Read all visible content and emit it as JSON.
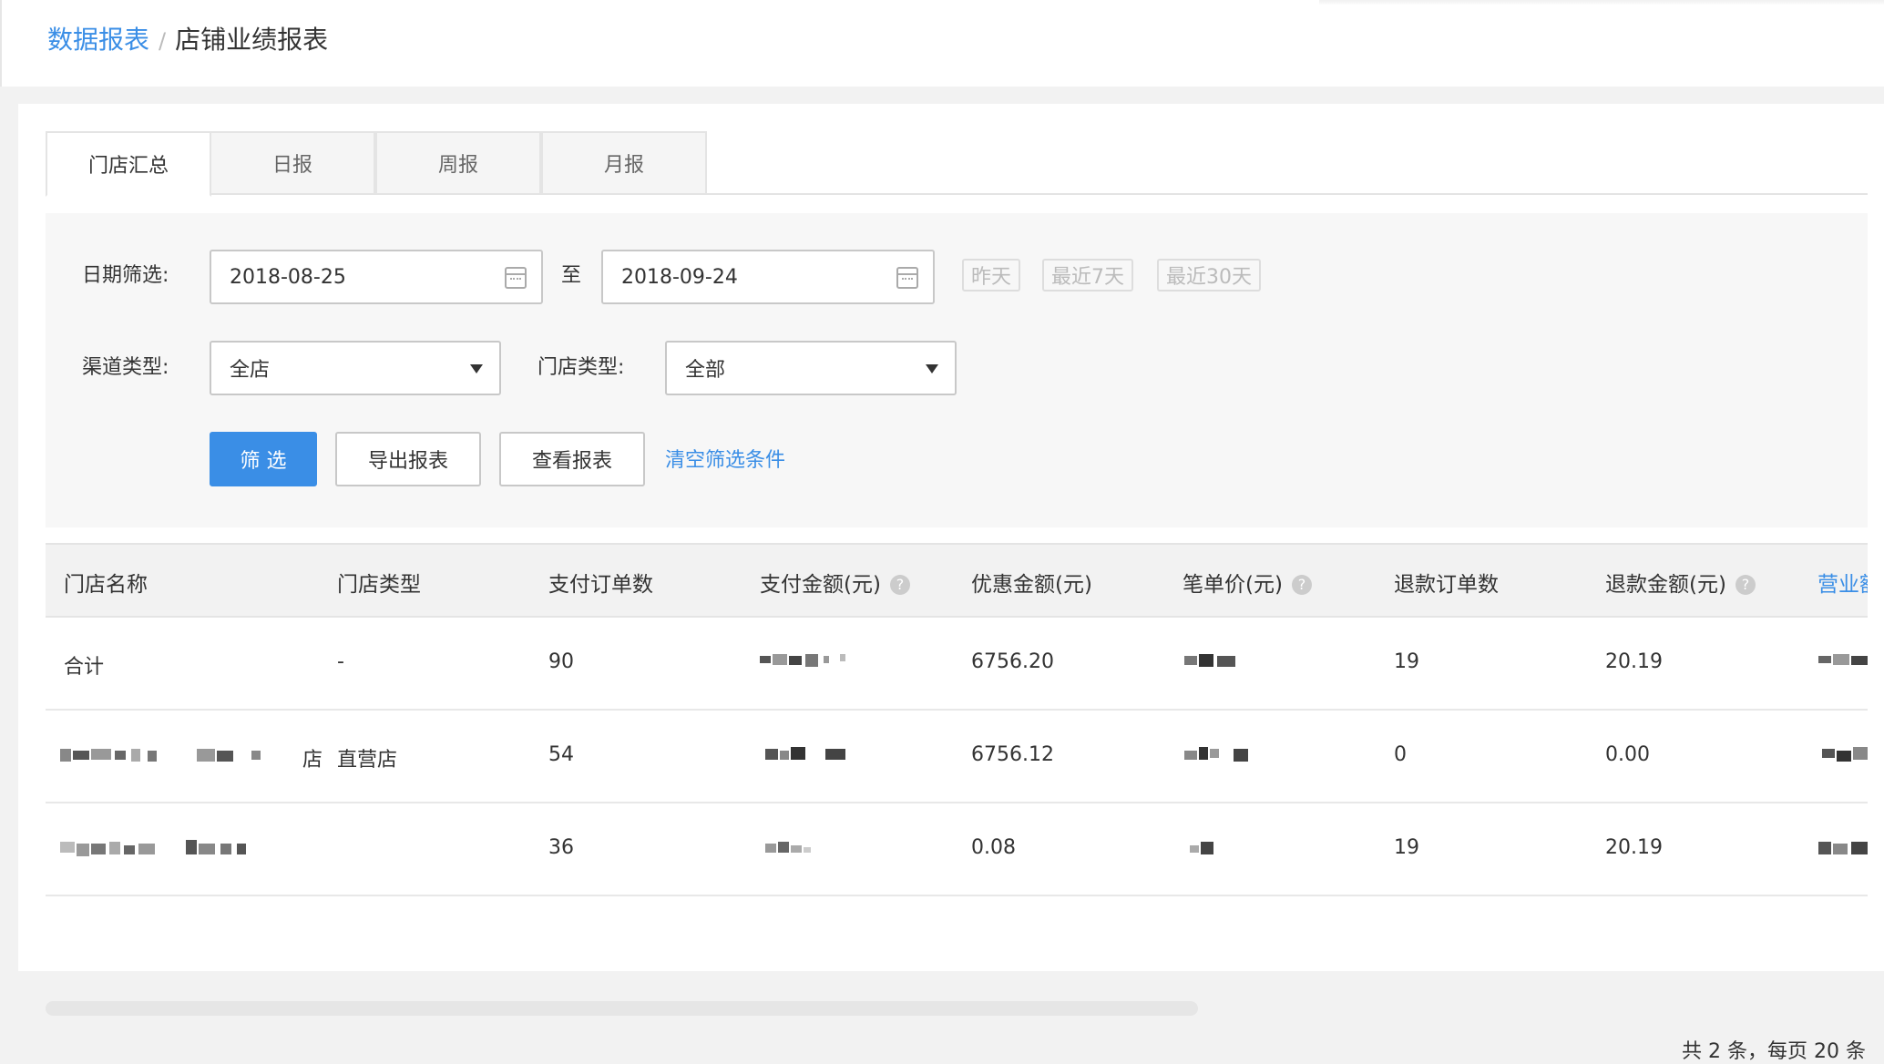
{
  "breadcrumb": {
    "parent": "数据报表",
    "separator": "/",
    "current": "店铺业绩报表"
  },
  "tabs": [
    {
      "label": "门店汇总",
      "active": true
    },
    {
      "label": "日报",
      "active": false
    },
    {
      "label": "周报",
      "active": false
    },
    {
      "label": "月报",
      "active": false
    }
  ],
  "filters": {
    "date_label": "日期筛选:",
    "start_date": "2018-08-25",
    "to_label": "至",
    "end_date": "2018-09-24",
    "quick_ranges": [
      "昨天",
      "最近7天",
      "最近30天"
    ],
    "channel_label": "渠道类型:",
    "channel_value": "全店",
    "store_type_label": "门店类型:",
    "store_type_value": "全部",
    "filter_button": "筛 选",
    "export_button": "导出报表",
    "view_button": "查看报表",
    "clear_link": "清空筛选条件"
  },
  "table": {
    "columns": [
      {
        "label": "门店名称",
        "help": false
      },
      {
        "label": "门店类型",
        "help": false
      },
      {
        "label": "支付订单数",
        "help": false
      },
      {
        "label": "支付金额(元)",
        "help": true
      },
      {
        "label": "优惠金额(元)",
        "help": false
      },
      {
        "label": "笔单价(元)",
        "help": true
      },
      {
        "label": "退款订单数",
        "help": false
      },
      {
        "label": "退款金额(元)",
        "help": true
      },
      {
        "label": "营业额",
        "help": false
      }
    ],
    "rows": [
      {
        "name": "合计",
        "store_type": "-",
        "paid_orders": "90",
        "discount": "6756.20",
        "refund_orders": "19",
        "refund_amount": "20.19"
      },
      {
        "name_suffix": "店",
        "store_type": "直营店",
        "paid_orders": "54",
        "discount": "6756.12",
        "refund_orders": "0",
        "refund_amount": "0.00"
      },
      {
        "store_type": "",
        "paid_orders": "36",
        "discount": "0.08",
        "refund_orders": "19",
        "refund_amount": "20.19"
      }
    ]
  },
  "pagination": {
    "summary": "共 2 条，每页 20 条"
  },
  "colors": {
    "accent": "#3a8ee6",
    "text": "#333333",
    "muted": "#bbbbbb"
  }
}
